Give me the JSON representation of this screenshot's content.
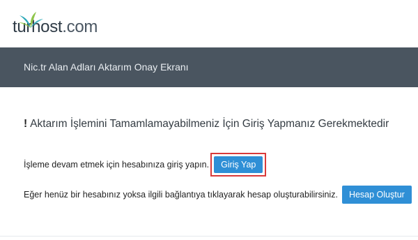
{
  "header": {
    "logo_brand": "turhost",
    "logo_tld": ".com"
  },
  "banner": {
    "title": "Nic.tr Alan Adları Aktarım Onay Ekranı"
  },
  "main": {
    "warning_symbol": "!",
    "warning_text": "Aktarım İşlemini Tamamlamayabilmeniz İçin Giriş Yapmanız Gerekmektedir",
    "login_prompt": "İşleme devam etmek için hesabınıza giriş yapın.",
    "login_button": "Giriş Yap",
    "register_prompt": "Eğer henüz bir hesabınız yoksa ilgili bağlantıya tıklayarak hesap oluşturabilirsiniz.",
    "register_button": "Hesap Oluştur"
  },
  "colors": {
    "banner_bg": "#4a5560",
    "button_bg": "#2f8fd6",
    "highlight_border": "#d93a3a",
    "logo_accent": "#2aa8b8"
  }
}
